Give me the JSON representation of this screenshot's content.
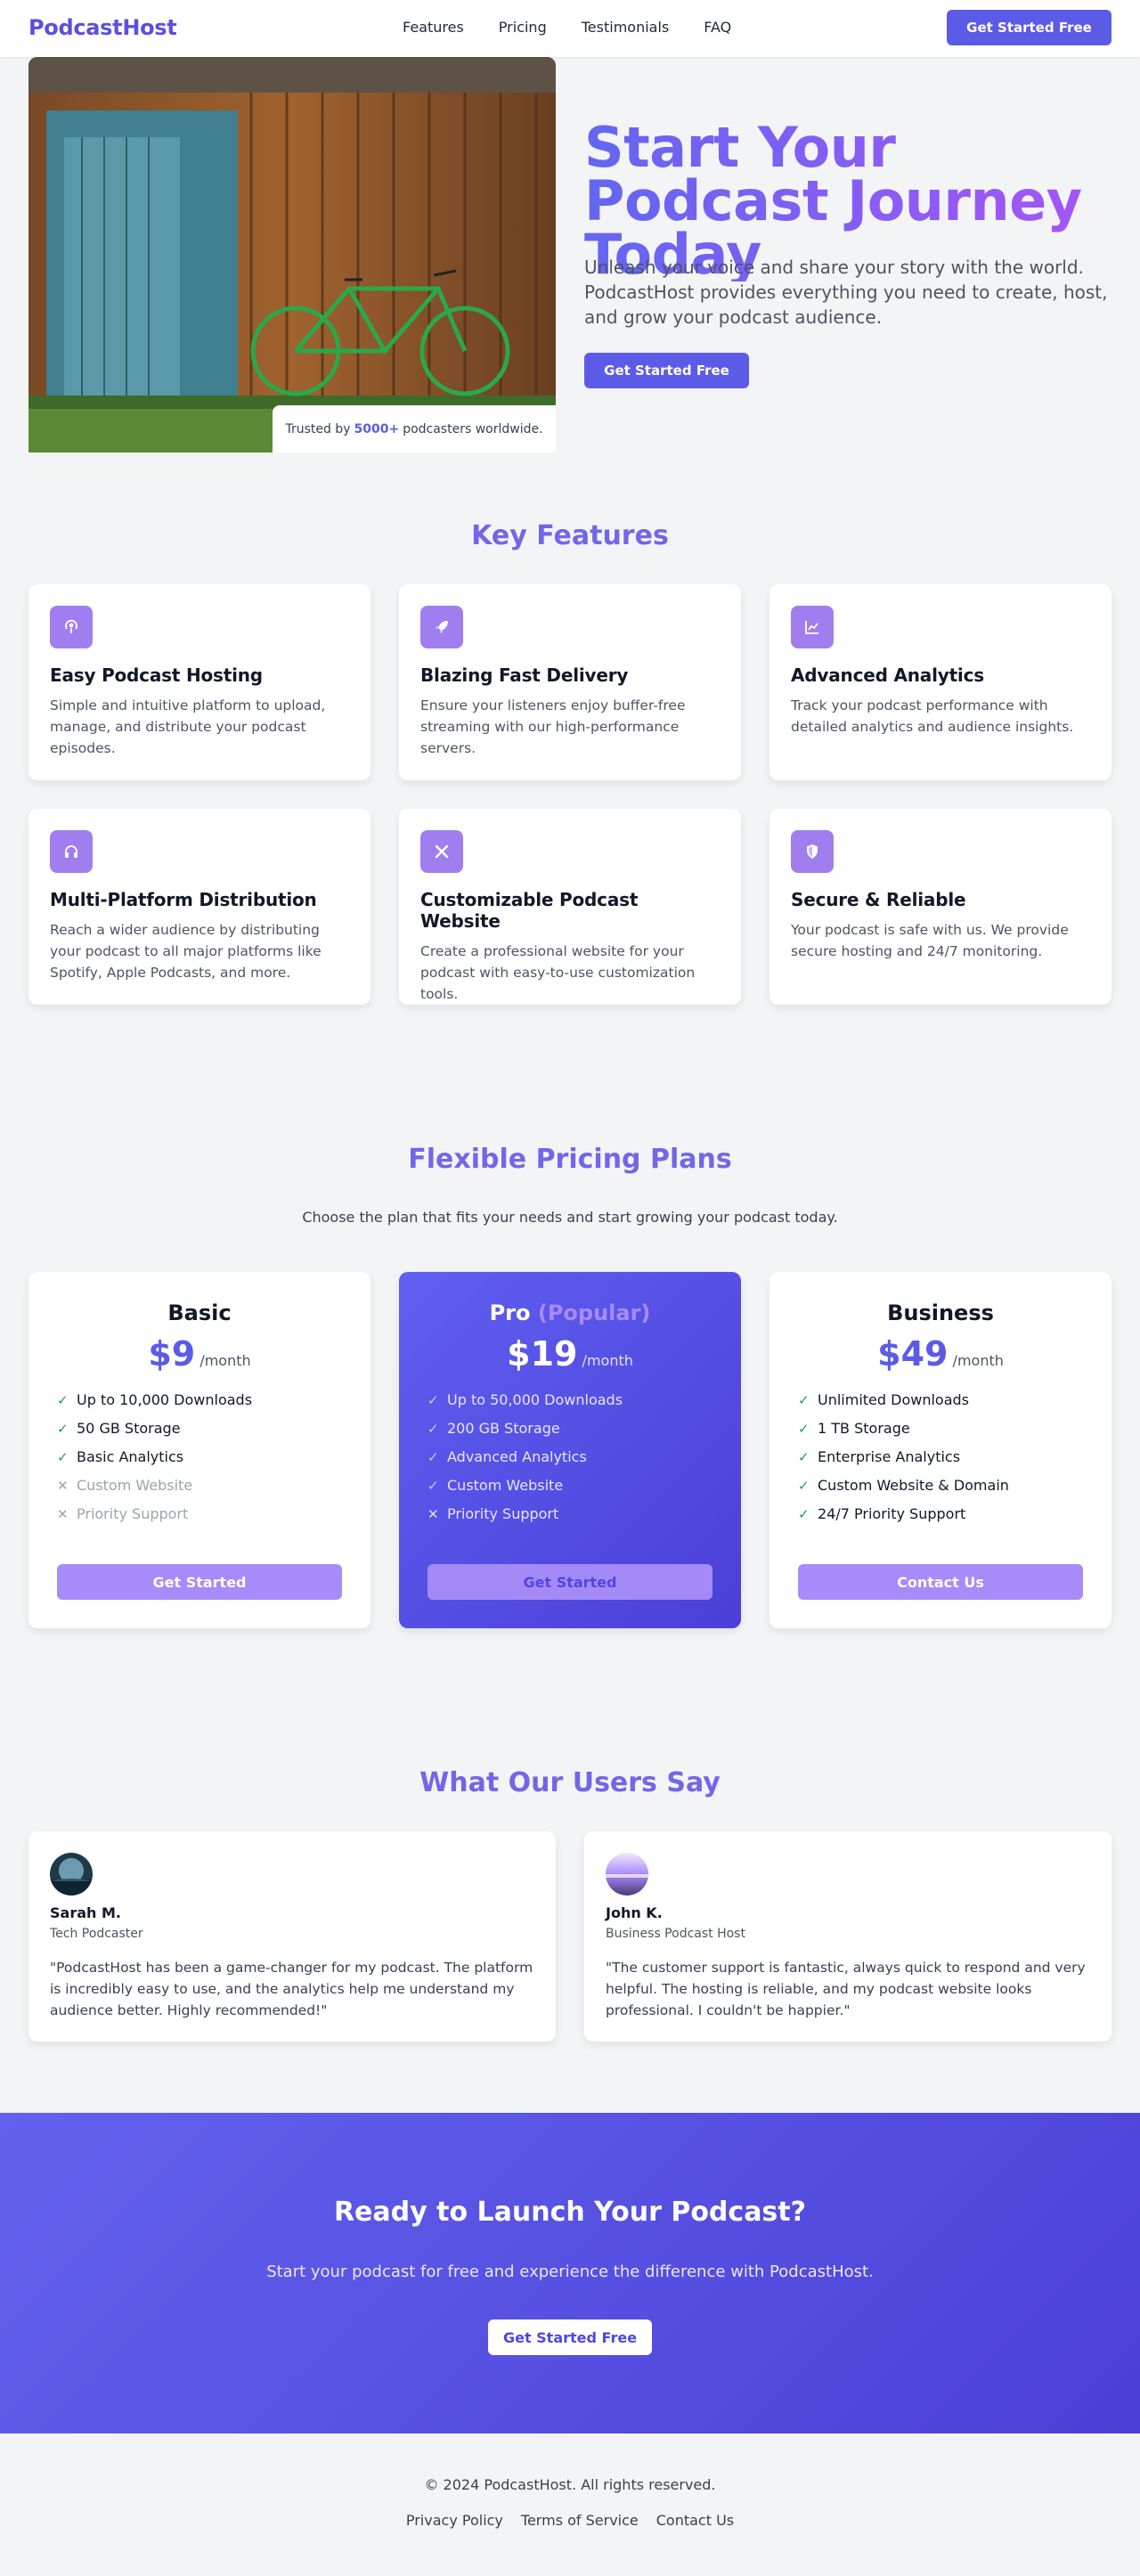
{
  "nav": {
    "brand": "PodcastHost",
    "links": [
      "Features",
      "Pricing",
      "Testimonials",
      "FAQ"
    ],
    "cta": "Get Started Free"
  },
  "hero": {
    "title": "Start Your Podcast Journey Today",
    "subtitle": "Unleash your voice and share your story with the world. PodcastHost provides everything you need to create, host, and grow your podcast audience.",
    "cta": "Get Started Free",
    "trust_prefix": "Trusted by",
    "trust_number": "5000+",
    "trust_suffix": "podcasters worldwide."
  },
  "features": {
    "title": "Key Features",
    "items": [
      {
        "icon": "podcast-icon",
        "title": "Easy Podcast Hosting",
        "text": "Simple and intuitive platform to upload, manage, and distribute your podcast episodes."
      },
      {
        "icon": "rocket-icon",
        "title": "Blazing Fast Delivery",
        "text": "Ensure your listeners enjoy buffer-free streaming with our high-performance servers."
      },
      {
        "icon": "chart-line-icon",
        "title": "Advanced Analytics",
        "text": "Track your podcast performance with detailed analytics and audience insights."
      },
      {
        "icon": "headphones-icon",
        "title": "Multi-Platform Distribution",
        "text": "Reach a wider audience by distributing your podcast to all major platforms like Spotify, Apple Podcasts, and more."
      },
      {
        "icon": "tools-icon",
        "title": "Customizable Podcast Website",
        "text": "Create a professional website for your podcast with easy-to-use customization tools."
      },
      {
        "icon": "shield-icon",
        "title": "Secure & Reliable",
        "text": "Your podcast is safe with us. We provide secure hosting and 24/7 monitoring."
      }
    ]
  },
  "pricing": {
    "title": "Flexible Pricing Plans",
    "subtitle": "Choose the plan that fits your needs and start growing your podcast today.",
    "plans": [
      {
        "name": "Basic",
        "tag": "",
        "price": "$9",
        "per": "/month",
        "button": "Get Started",
        "features": [
          {
            "text": "Up to 10,000 Downloads",
            "included": true
          },
          {
            "text": "50 GB Storage",
            "included": true
          },
          {
            "text": "Basic Analytics",
            "included": true
          },
          {
            "text": "Custom Website",
            "included": false
          },
          {
            "text": "Priority Support",
            "included": false
          }
        ]
      },
      {
        "name": "Pro",
        "tag": "(Popular)",
        "price": "$19",
        "per": "/month",
        "button": "Get Started",
        "features": [
          {
            "text": "Up to 50,000 Downloads",
            "included": true
          },
          {
            "text": "200 GB Storage",
            "included": true
          },
          {
            "text": "Advanced Analytics",
            "included": true
          },
          {
            "text": "Custom Website",
            "included": true
          },
          {
            "text": "Priority Support",
            "included": false
          }
        ]
      },
      {
        "name": "Business",
        "tag": "",
        "price": "$49",
        "per": "/month",
        "button": "Contact Us",
        "features": [
          {
            "text": "Unlimited Downloads",
            "included": true
          },
          {
            "text": "1 TB Storage",
            "included": true
          },
          {
            "text": "Enterprise Analytics",
            "included": true
          },
          {
            "text": "Custom Website & Domain",
            "included": true
          },
          {
            "text": "24/7 Priority Support",
            "included": true
          }
        ]
      }
    ]
  },
  "testimonials": {
    "title": "What Our Users Say",
    "items": [
      {
        "name": "Sarah M.",
        "role": "Tech Podcaster",
        "quote": "\"PodcastHost has been a game-changer for my podcast. The platform is incredibly easy to use, and the analytics help me understand my audience better. Highly recommended!\""
      },
      {
        "name": "John K.",
        "role": "Business Podcast Host",
        "quote": "\"The customer support is fantastic, always quick to respond and very helpful. The hosting is reliable, and my podcast website looks professional. I couldn't be happier.\""
      }
    ]
  },
  "cta_band": {
    "title": "Ready to Launch Your Podcast?",
    "subtitle": "Start your podcast for free and experience the difference with PodcastHost.",
    "button": "Get Started Free"
  },
  "footer": {
    "copyright": "© 2024 PodcastHost. All rights reserved.",
    "links": [
      "Privacy Policy",
      "Terms of Service",
      "Contact Us"
    ]
  },
  "colors": {
    "accent": "#5b5be8",
    "accent_light": "#a78bfa",
    "check": "#16a34a"
  }
}
